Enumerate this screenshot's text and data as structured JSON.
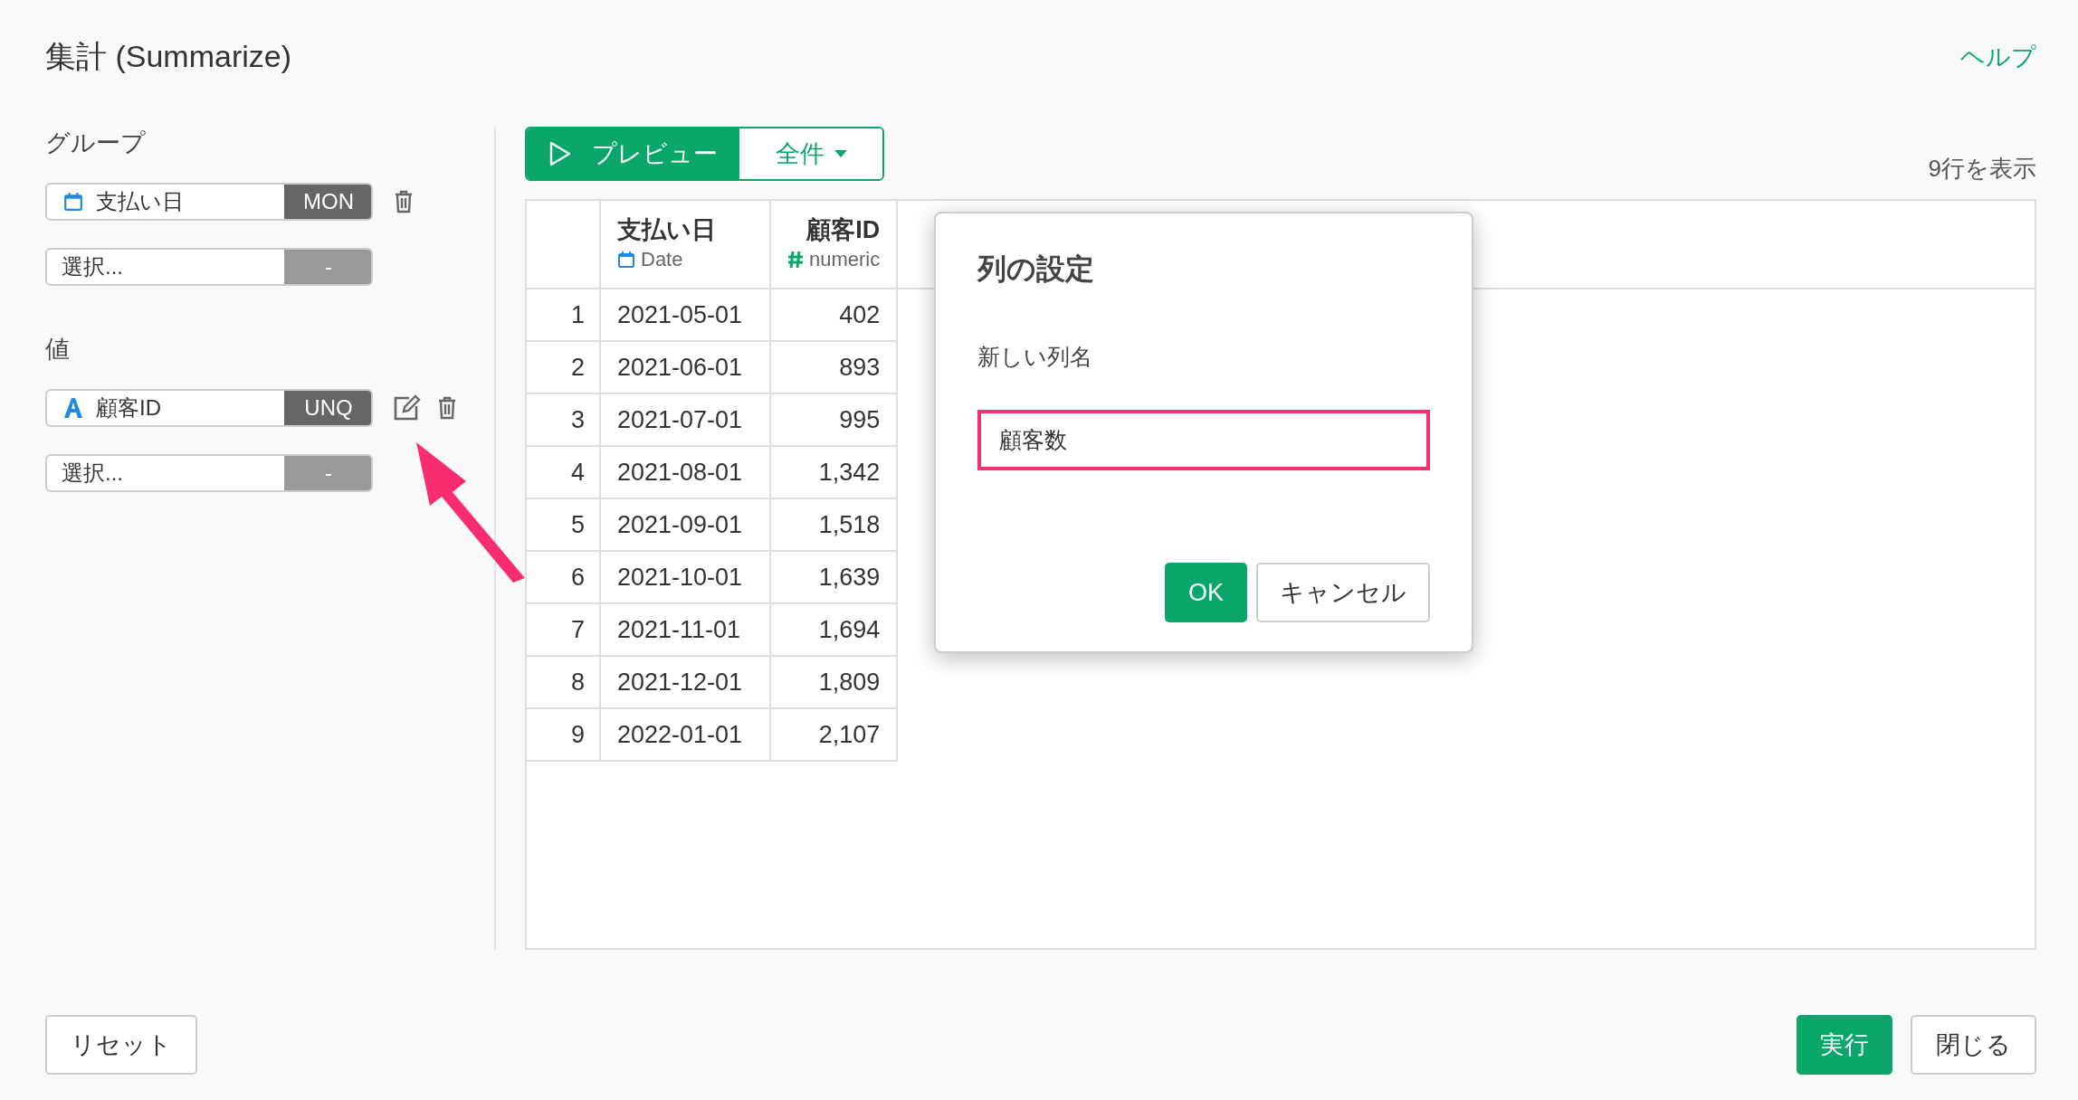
{
  "title": "集計 (Summarize)",
  "help_link": "ヘルプ",
  "sections": [
    {
      "label": "グループ",
      "items": [
        {
          "kind": "date",
          "name": "支払い日",
          "badge": "MON",
          "editable": false,
          "deletable": true
        },
        {
          "kind": "empty",
          "name": "選択...",
          "badge": "-",
          "editable": false,
          "deletable": false
        }
      ]
    },
    {
      "label": "値",
      "items": [
        {
          "kind": "text",
          "name": "顧客ID",
          "badge": "UNQ",
          "editable": true,
          "deletable": true
        },
        {
          "kind": "empty",
          "name": "選択...",
          "badge": "-",
          "editable": false,
          "deletable": false
        }
      ]
    }
  ],
  "toolbar": {
    "preview_button": "プレビュー",
    "range_dropdown": "全件",
    "row_count": "9行を表示"
  },
  "table": {
    "columns": [
      {
        "name": "支払い日",
        "type": "Date",
        "kind": "date"
      },
      {
        "name": "顧客ID",
        "type": "numeric",
        "kind": "numeric"
      }
    ],
    "rows": [
      {
        "number": "1",
        "cells": [
          "2021-05-01",
          "402"
        ]
      },
      {
        "number": "2",
        "cells": [
          "2021-06-01",
          "893"
        ]
      },
      {
        "number": "3",
        "cells": [
          "2021-07-01",
          "995"
        ]
      },
      {
        "number": "4",
        "cells": [
          "2021-08-01",
          "1,342"
        ]
      },
      {
        "number": "5",
        "cells": [
          "2021-09-01",
          "1,518"
        ]
      },
      {
        "number": "6",
        "cells": [
          "2021-10-01",
          "1,639"
        ]
      },
      {
        "number": "7",
        "cells": [
          "2021-11-01",
          "1,694"
        ]
      },
      {
        "number": "8",
        "cells": [
          "2021-12-01",
          "1,809"
        ]
      },
      {
        "number": "9",
        "cells": [
          "2022-01-01",
          "2,107"
        ]
      }
    ]
  },
  "dialog": {
    "title": "列の設定",
    "field_label": "新しい列名",
    "value": "顧客数",
    "ok_button": "OK",
    "cancel_button": "キャンセル"
  },
  "footer": {
    "reset_button": "リセット",
    "run_button": "実行",
    "close_button": "閉じる"
  }
}
